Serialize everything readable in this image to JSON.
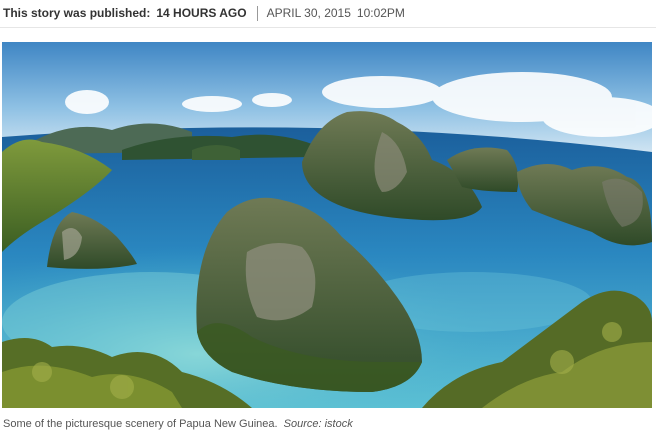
{
  "story_meta": {
    "published_label": "This story was published:",
    "published_ago": "14 HOURS AGO",
    "published_date": "APRIL 30, 2015",
    "published_time": "10:02PM"
  },
  "photo": {
    "subject": "islands-lagoon-photo"
  },
  "caption": {
    "text": "Some of the picturesque scenery of Papua New Guinea.",
    "source": "Source: istock"
  }
}
